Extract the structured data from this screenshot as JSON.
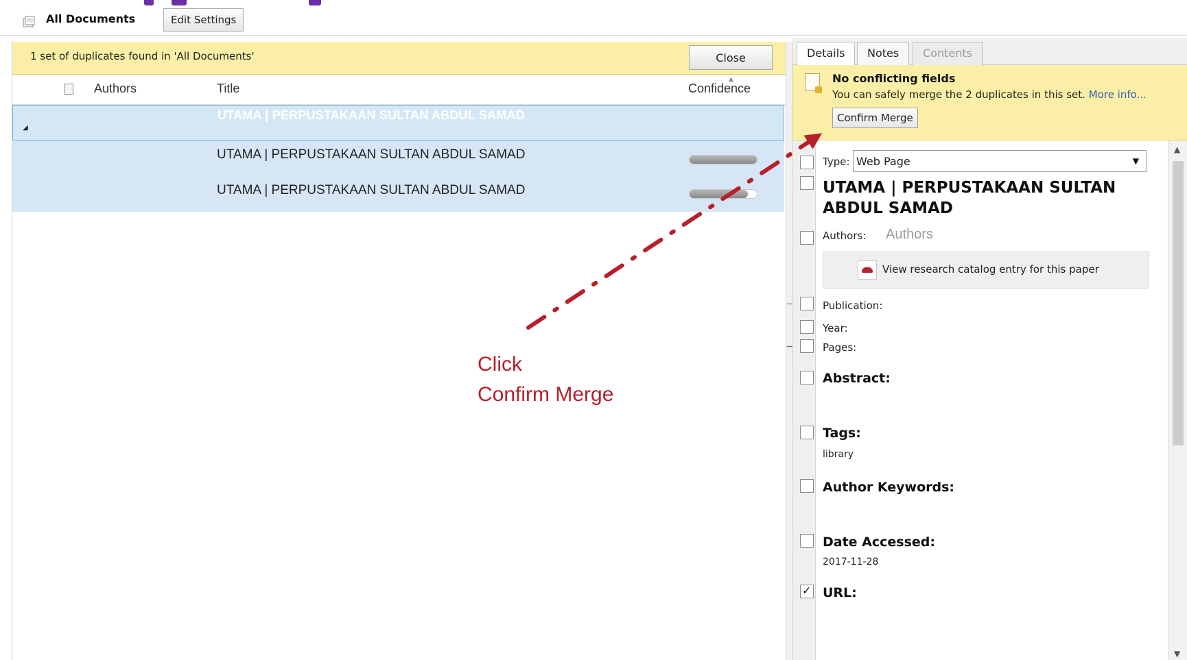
{
  "toolbar": {
    "folder_label": "All Documents",
    "edit_settings_label": "Edit Settings"
  },
  "duplicates": {
    "banner_text": "1 set of duplicates found in 'All Documents'",
    "close_label": "Close",
    "columns": {
      "authors": "Authors",
      "title": "Title",
      "confidence": "Confidence"
    },
    "group_title": "UTAMA | PERPUSTAKAAN SULTAN ABDUL SAMAD",
    "rows": [
      {
        "title": "UTAMA | PERPUSTAKAAN SULTAN ABDUL SAMAD",
        "confidence": 1.0
      },
      {
        "title": "UTAMA | PERPUSTAKAAN SULTAN ABDUL SAMAD",
        "confidence": 0.87
      }
    ]
  },
  "details": {
    "tabs": [
      {
        "label": "Details",
        "state": "active"
      },
      {
        "label": "Notes",
        "state": "normal"
      },
      {
        "label": "Contents",
        "state": "disabled"
      }
    ],
    "merge_banner": {
      "title": "No conflicting fields",
      "message": "You can safely merge the 2 duplicates in this set.",
      "more_info": "More info...",
      "confirm_label": "Confirm Merge"
    },
    "type_label": "Type:",
    "type_value": "Web Page",
    "doc_title": "UTAMA | PERPUSTAKAAN SULTAN ABDUL SAMAD",
    "authors_label": "Authors:",
    "authors_placeholder": "Authors",
    "catalog_button": "View research catalog entry for this paper",
    "publication_label": "Publication:",
    "year_label": "Year:",
    "pages_label": "Pages:",
    "abstract_label": "Abstract:",
    "tags_label": "Tags:",
    "tags_value": "library",
    "keywords_label": "Author Keywords:",
    "date_accessed_label": "Date Accessed:",
    "date_accessed_value": "2017-11-28",
    "url_label": "URL:"
  },
  "annotation": {
    "line1": "Click",
    "line2": "Confirm Merge",
    "color": "#b5202a"
  }
}
